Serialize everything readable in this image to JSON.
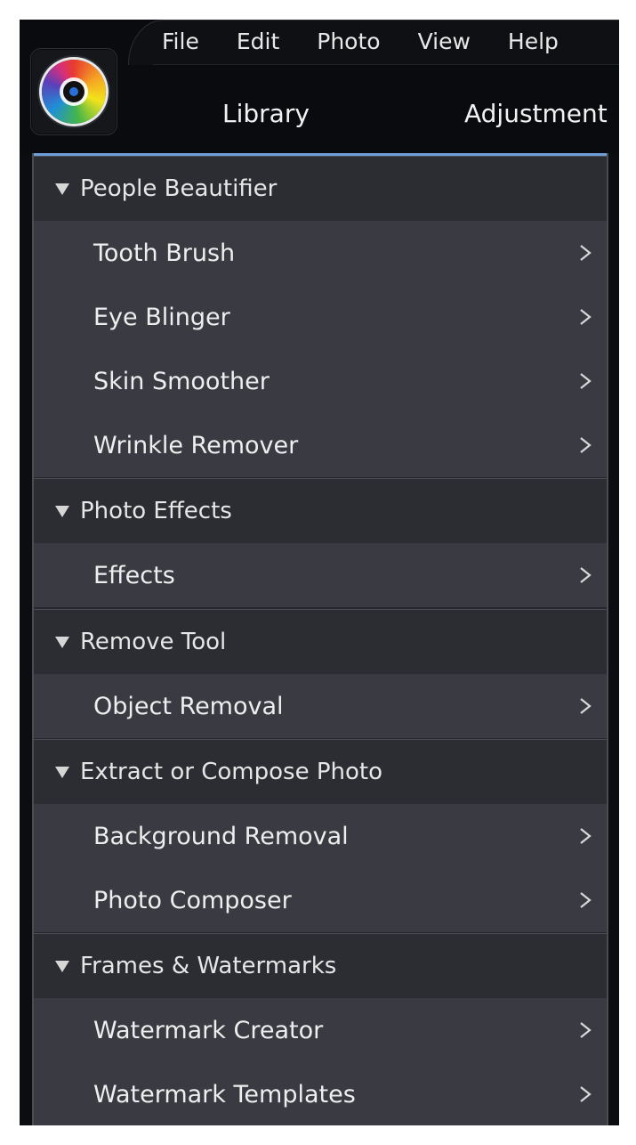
{
  "menu": {
    "items": [
      "File",
      "Edit",
      "Photo",
      "View",
      "Help"
    ]
  },
  "mode_tabs": [
    "Library",
    "Adjustment"
  ],
  "colors": {
    "accent": "#6f9fd8",
    "panel": "#3a3b42",
    "header": "#2c2d33",
    "titlebar": "#0a0b0e"
  },
  "groups": [
    {
      "title": "People Beautifier",
      "items": [
        "Tooth Brush",
        "Eye Blinger",
        "Skin Smoother",
        "Wrinkle Remover"
      ]
    },
    {
      "title": "Photo Effects",
      "items": [
        "Effects"
      ]
    },
    {
      "title": "Remove Tool",
      "items": [
        "Object Removal"
      ]
    },
    {
      "title": "Extract or Compose Photo",
      "items": [
        "Background Removal",
        "Photo Composer"
      ]
    },
    {
      "title": "Frames & Watermarks",
      "items": [
        "Watermark Creator",
        "Watermark Templates"
      ]
    }
  ],
  "icons": {
    "expand": "triangle-down-icon",
    "open": "chevron-right-icon",
    "app_logo": "app-logo-icon"
  }
}
